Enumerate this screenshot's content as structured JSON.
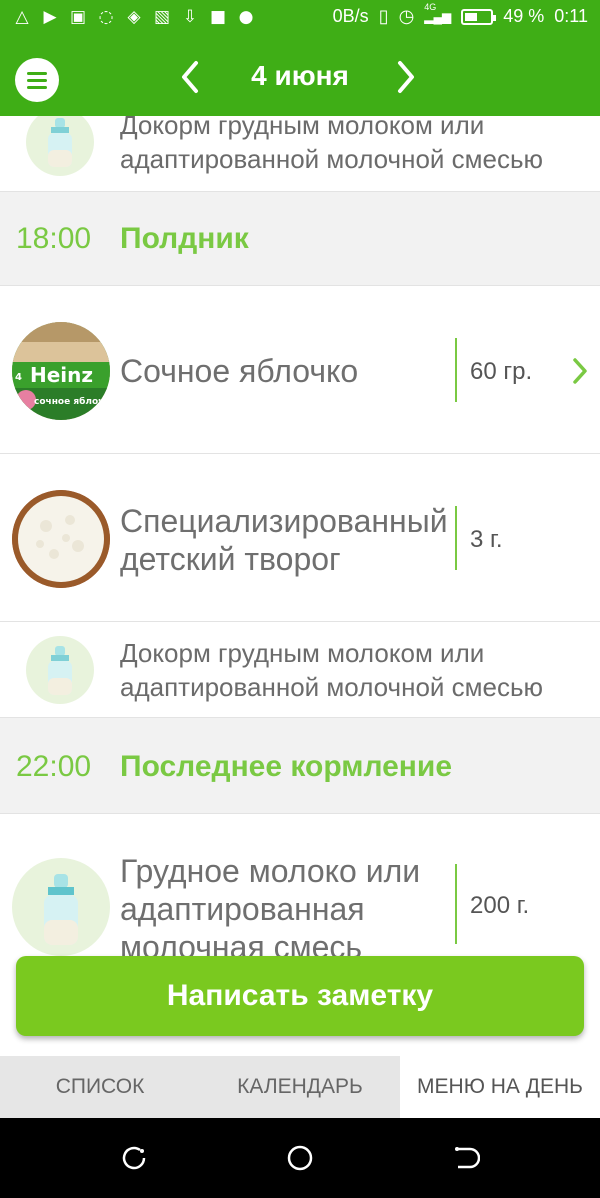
{
  "status_bar": {
    "icons_left": [
      "alert-icon",
      "youtube-icon",
      "gallery-icon",
      "chat-icon",
      "shield-icon",
      "cast-icon",
      "download-icon",
      "lock-icon",
      "dot-icon"
    ],
    "network_speed": "0B/s",
    "network_type": "4G",
    "battery_percent_text": "49 %",
    "battery_level": 0.49,
    "time": "0:11"
  },
  "header": {
    "date": "4 июня",
    "menu_icon": "menu-icon",
    "prev_icon": "chevron-left-icon",
    "next_icon": "chevron-right-icon",
    "color": "#3fae16"
  },
  "feed": [
    {
      "kind": "note",
      "text": "Докорм грудным молоком или адаптированной молочной смесью"
    },
    {
      "kind": "section",
      "time": "18:00",
      "meal": "Полдник"
    },
    {
      "kind": "food",
      "name": "Сочное яблочко",
      "qty": "60 гр.",
      "image": "heinz-apple-puree",
      "has_arrow": true
    },
    {
      "kind": "food",
      "name": "Специализированный детский творог",
      "qty": "3 г.",
      "image": "cottage-cheese-bowl"
    },
    {
      "kind": "note",
      "text": "Докорм грудным молоком или адаптированной молочной смесью"
    },
    {
      "kind": "section",
      "time": "22:00",
      "meal": "Последнее кормление"
    },
    {
      "kind": "food",
      "name": "Грудное молоко или адаптированная молочная смесь",
      "qty": "200 г.",
      "image": "baby-bottle"
    }
  ],
  "heinz_label": {
    "brand": "Heinz",
    "age": "4",
    "product": "сочное яблочко"
  },
  "note_button": {
    "label": "Написать заметку"
  },
  "tabs": [
    {
      "label": "СПИСОК"
    },
    {
      "label": "КАЛЕНДАРЬ"
    },
    {
      "label": "МЕНЮ НА ДЕНЬ",
      "active": true
    }
  ],
  "system_nav": [
    "recent-apps-icon",
    "home-icon",
    "back-icon"
  ],
  "colors": {
    "accent": "#7ac943",
    "primary": "#3fae16",
    "button": "#7ac91f"
  }
}
